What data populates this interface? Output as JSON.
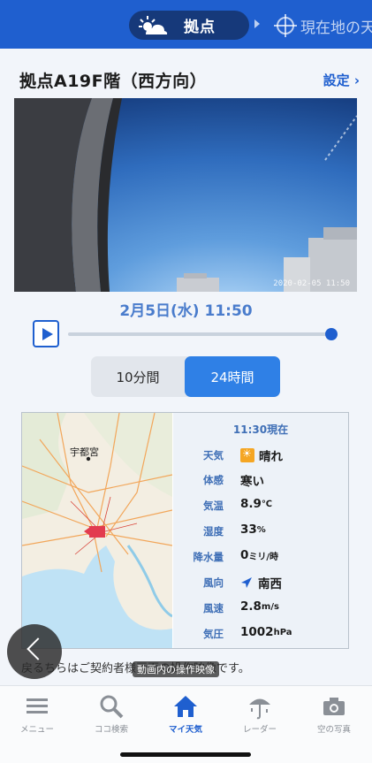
{
  "header": {
    "active_tab": "拠点",
    "other_tab": "現在地の天"
  },
  "page": {
    "title": "拠点A19F階（西方向）",
    "settings_label": "設定 ›"
  },
  "camera": {
    "timestamp": "2020-02-05 11:50"
  },
  "playback": {
    "datetime": "2月5日(水) 11:50",
    "progress": 1.0
  },
  "interval": {
    "option_a": "10分間",
    "option_b": "24時間",
    "selected": "24時間"
  },
  "map": {
    "city_label": "宇都宮"
  },
  "observation": {
    "heading": "11:30現在",
    "rows": [
      {
        "key": "天気",
        "value": "晴れ",
        "icon": "sun-icon"
      },
      {
        "key": "体感",
        "value": "寒い"
      },
      {
        "key": "気温",
        "value": "8.9",
        "unit": "℃"
      },
      {
        "key": "湿度",
        "value": "33",
        "unit": "%"
      },
      {
        "key": "降水量",
        "value": "0",
        "unit": "ミリ/時"
      },
      {
        "key": "風向",
        "value": "南西",
        "icon": "wind-arrow-icon"
      },
      {
        "key": "風速",
        "value": "2.8",
        "unit": "m/s"
      },
      {
        "key": "気圧",
        "value": "1002",
        "unit": "hPa"
      }
    ]
  },
  "notice": {
    "text": "戻るちらはご契約者様画面の操作映像です。",
    "overlay": "動画内の操作映像"
  },
  "nav": {
    "items": [
      {
        "label": "メニュー",
        "icon": "menu-icon"
      },
      {
        "label": "ココ検索",
        "icon": "search-icon"
      },
      {
        "label": "マイ天気",
        "icon": "home-icon"
      },
      {
        "label": "レーダー",
        "icon": "radar-umbrella-icon"
      },
      {
        "label": "空の写真",
        "icon": "camera-icon"
      }
    ],
    "active_index": 2
  },
  "colors": {
    "accent": "#1f5fcf",
    "header": "#1f5fcf",
    "pill": "#16397a",
    "segment_active": "#2f80e6"
  }
}
